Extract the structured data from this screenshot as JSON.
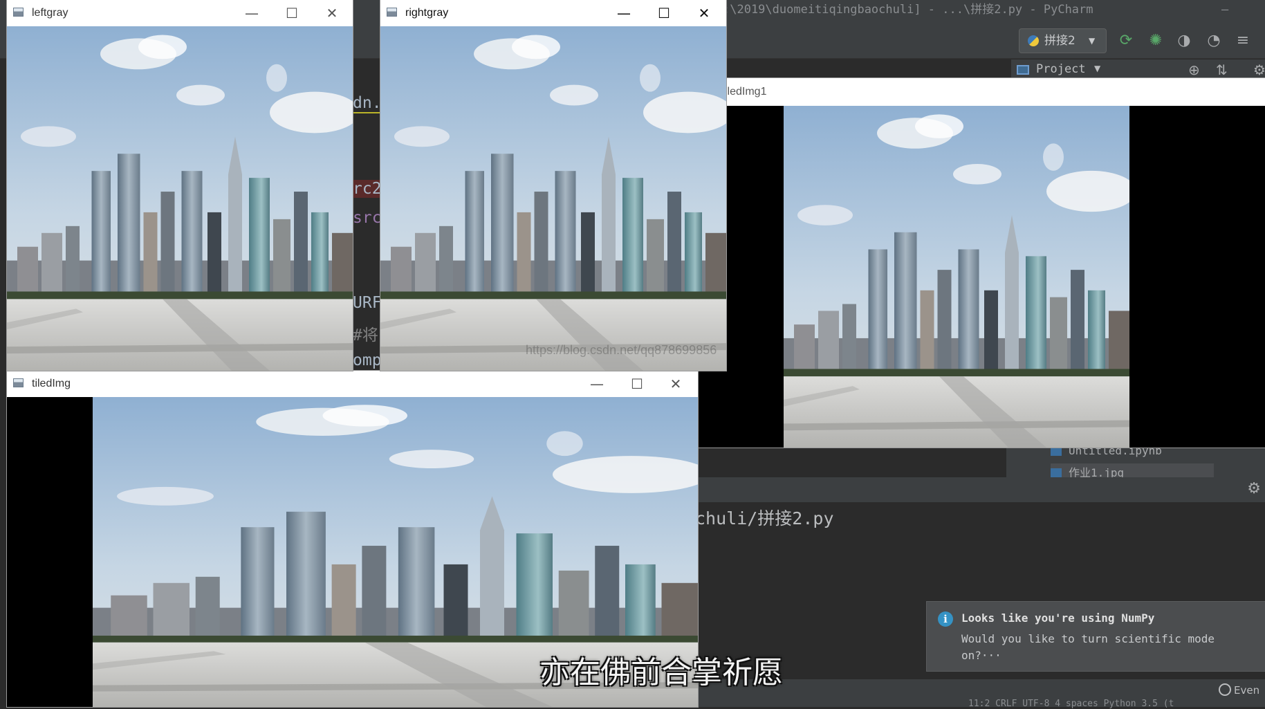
{
  "pycharm": {
    "title": ":\\2019\\duomeitiqingbaochuli] - ...\\拼接2.py - PyCharm",
    "run_config": "拼接2",
    "project_label": "Project",
    "code_fragments": [
      "dn.",
      "rc2",
      "src",
      "URF",
      "#将",
      "omp"
    ],
    "tree_items": [
      "Untitled.ipynb",
      "作业1.jpg"
    ],
    "run_path": "chuli/拼接2.py",
    "event_log": "Even",
    "status_text": "11:2   CRLF   UTF-8   4 spaces   Python 3.5 (t"
  },
  "notification": {
    "title": "Looks like you're using NumPy",
    "message": "Would you like to turn scientific mode on?···"
  },
  "windows": {
    "leftgray": {
      "title": "leftgray"
    },
    "rightgray": {
      "title": "rightgray"
    },
    "tiledImg": {
      "title": "tiledImg"
    },
    "tiledImg1": {
      "title": "iledImg1"
    }
  },
  "window_controls": {
    "minimize": "—",
    "maximize": "☐",
    "close": "✕"
  },
  "watermark": "https://blog.csdn.net/qq878699856",
  "subtitle": "亦在佛前合掌祈愿",
  "colors": {
    "ide_bg": "#2b2b2b",
    "ide_panel": "#3c3f41",
    "sky": "#b9cde0",
    "plaza": "#c9c9c6"
  }
}
